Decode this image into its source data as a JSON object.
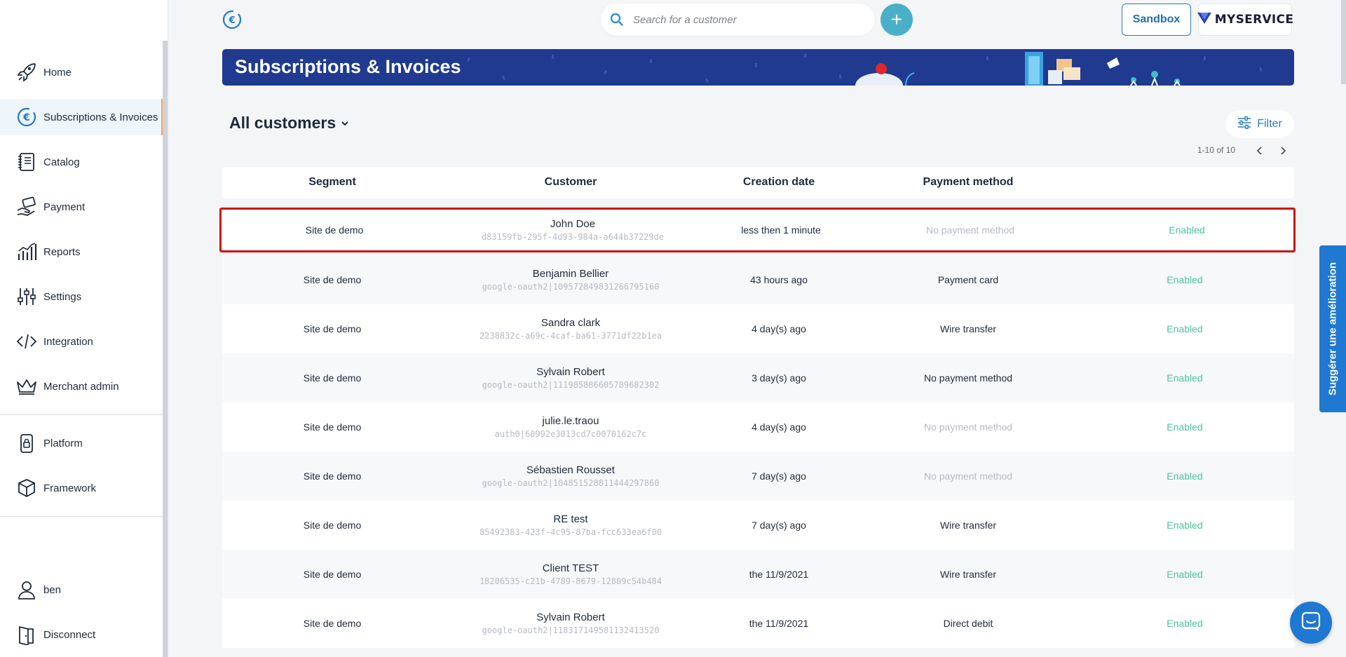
{
  "sidebar": {
    "items": [
      {
        "label": "Home",
        "icon": "rocket-icon"
      },
      {
        "label": "Subscriptions & Invoices",
        "icon": "euro-cycle-icon",
        "active": true
      },
      {
        "label": "Catalog",
        "icon": "notebook-icon"
      },
      {
        "label": "Payment",
        "icon": "hand-card-icon"
      },
      {
        "label": "Reports",
        "icon": "chart-icon"
      },
      {
        "label": "Settings",
        "icon": "sliders-icon"
      },
      {
        "label": "Integration",
        "icon": "code-icon"
      },
      {
        "label": "Merchant admin",
        "icon": "crown-icon"
      },
      {
        "label": "Platform",
        "icon": "lock-phone-icon"
      },
      {
        "label": "Framework",
        "icon": "box-icon"
      },
      {
        "label": "ben",
        "icon": "user-icon"
      },
      {
        "label": "Disconnect",
        "icon": "door-icon"
      }
    ]
  },
  "topbar": {
    "search_placeholder": "Search for a customer",
    "add_label": "+",
    "sandbox_label": "Sandbox",
    "brand_text": "MYSERVICE"
  },
  "banner": {
    "title": "Subscriptions & Invoices"
  },
  "list": {
    "title": "All customers",
    "filter_label": "Filter",
    "pagination": "1-10 of 10"
  },
  "table": {
    "headers": [
      "Segment",
      "Customer",
      "Creation date",
      "Payment method"
    ],
    "rows": [
      {
        "segment": "Site de demo",
        "name": "John Doe",
        "id": "d83159fb-295f-4d93-984a-a644b37229de",
        "created": "less then 1 minute",
        "payment": "No payment method",
        "payment_muted": true,
        "status": "Enabled"
      },
      {
        "segment": "Site de demo",
        "name": "Benjamin Bellier",
        "id": "google-oauth2|109572849831266795160",
        "created": "43 hours ago",
        "payment": "Payment card",
        "payment_muted": false,
        "status": "Enabled"
      },
      {
        "segment": "Site de demo",
        "name": "Sandra clark",
        "id": "2238832c-a69c-4caf-ba61-3771df22b1ea",
        "created": "4 day(s) ago",
        "payment": "Wire transfer",
        "payment_muted": false,
        "status": "Enabled"
      },
      {
        "segment": "Site de demo",
        "name": "Sylvain Robert",
        "id": "google-oauth2|111985886605789682302",
        "created": "3 day(s) ago",
        "payment": "No payment method",
        "payment_muted": false,
        "status": "Enabled"
      },
      {
        "segment": "Site de demo",
        "name": "julie.le.traou",
        "id": "auth0|60992e3013cd7c0070162c7c",
        "created": "4 day(s) ago",
        "payment": "No payment method",
        "payment_muted": true,
        "status": "Enabled"
      },
      {
        "segment": "Site de demo",
        "name": "Sébastien Rousset",
        "id": "google-oauth2|104851528811444297860",
        "created": "7 day(s) ago",
        "payment": "No payment method",
        "payment_muted": true,
        "status": "Enabled"
      },
      {
        "segment": "Site de demo",
        "name": "RE test",
        "id": "85492383-423f-4c95-87ba-fcc633ea6f00",
        "created": "7 day(s) ago",
        "payment": "Wire transfer",
        "payment_muted": false,
        "status": "Enabled"
      },
      {
        "segment": "Site de demo",
        "name": "Client TEST",
        "id": "18206535-c21b-4789-8679-12809c54b484",
        "created": "the 11/9/2021",
        "payment": "Wire transfer",
        "payment_muted": false,
        "status": "Enabled"
      },
      {
        "segment": "Site de demo",
        "name": "Sylvain Robert",
        "id": "google-oauth2|118317149581132413520",
        "created": "the 11/9/2021",
        "payment": "Direct debit",
        "payment_muted": false,
        "status": "Enabled"
      }
    ]
  },
  "feedback": {
    "label": "Suggérer une amélioration"
  },
  "colors": {
    "accent": "#1f78d1",
    "banner": "#1f3a8f",
    "status_enabled": "#4dc39a",
    "highlight": "#cc1111"
  }
}
